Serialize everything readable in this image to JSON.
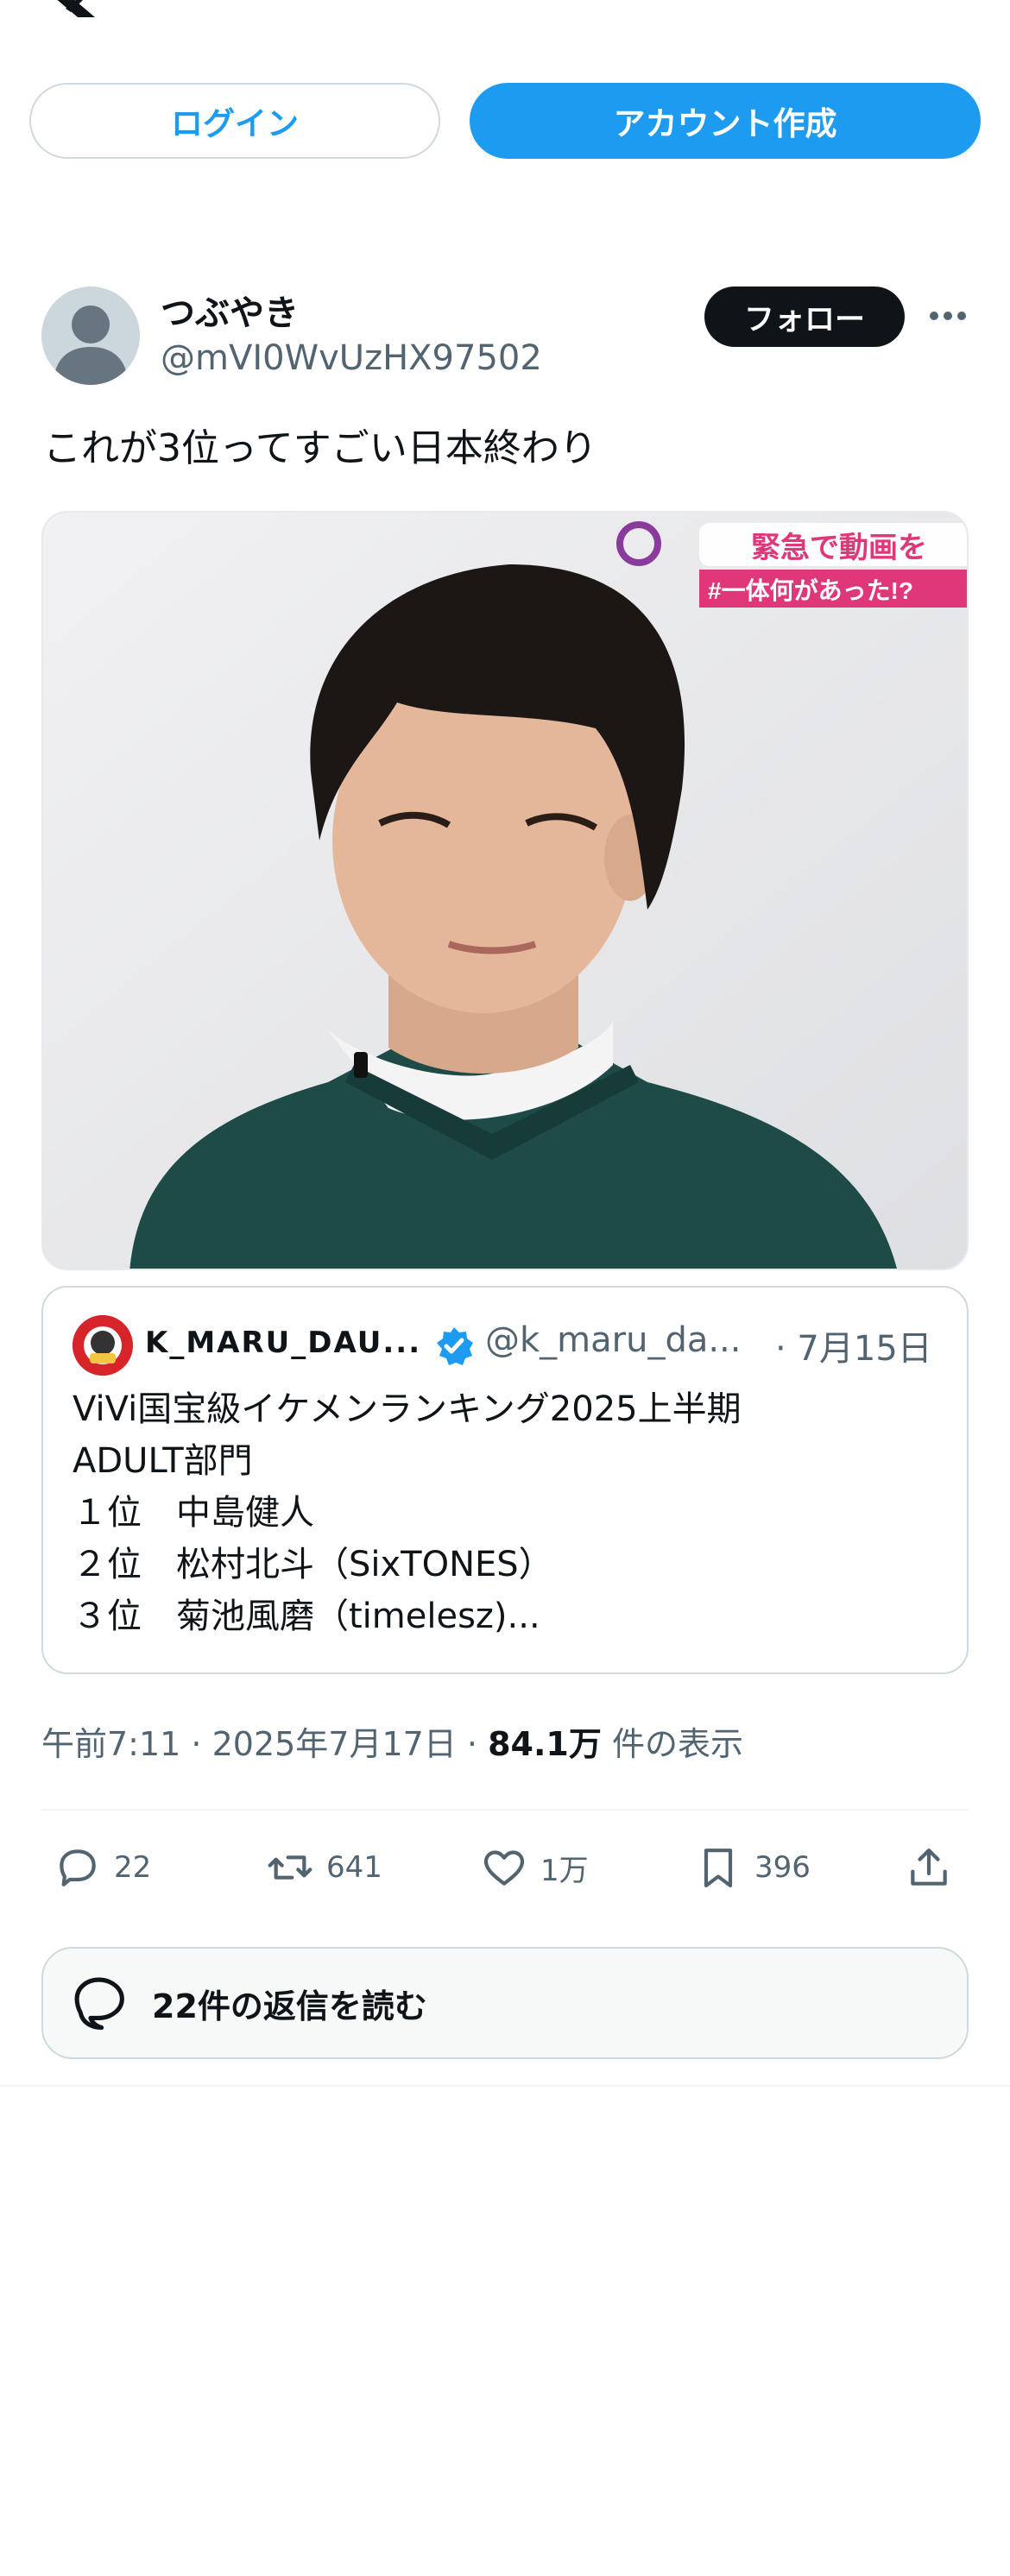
{
  "header": {
    "logo": "x-logo-icon"
  },
  "auth": {
    "login_label": "ログイン",
    "signup_label": "アカウント作成"
  },
  "tweet": {
    "display_name": "つぶやき",
    "handle": "@mVI0WvUzHX97502",
    "follow_label": "フォロー",
    "text": "これが3位ってすごい日本終わり",
    "media": {
      "caption_top": "緊急で動画を",
      "caption_bottom": "#一体何があった!?"
    }
  },
  "quote": {
    "name": "K_MARU_DAU...",
    "handle": "@k_maru_da...",
    "date": "· 7月15日",
    "lines": [
      "ViVi国宝級イケメンランキング2025上半期",
      "ADULT部門",
      "１位　中島健人",
      "２位　松村北斗（SixTONES）",
      "３位　菊池風磨（timelesz)..."
    ]
  },
  "meta": {
    "time": "午前7:11",
    "sep": " · ",
    "date": "2025年7月17日",
    "views_count": "84.1万",
    "views_label": " 件の表示"
  },
  "actions": {
    "replies": "22",
    "reposts": "641",
    "likes": "1万",
    "bookmarks": "396"
  },
  "read_replies_label": "22件の返信を読む",
  "colors": {
    "accent": "#1d9bf0",
    "text": "#0f1419",
    "muted": "#536471",
    "border": "#cfd9de"
  }
}
